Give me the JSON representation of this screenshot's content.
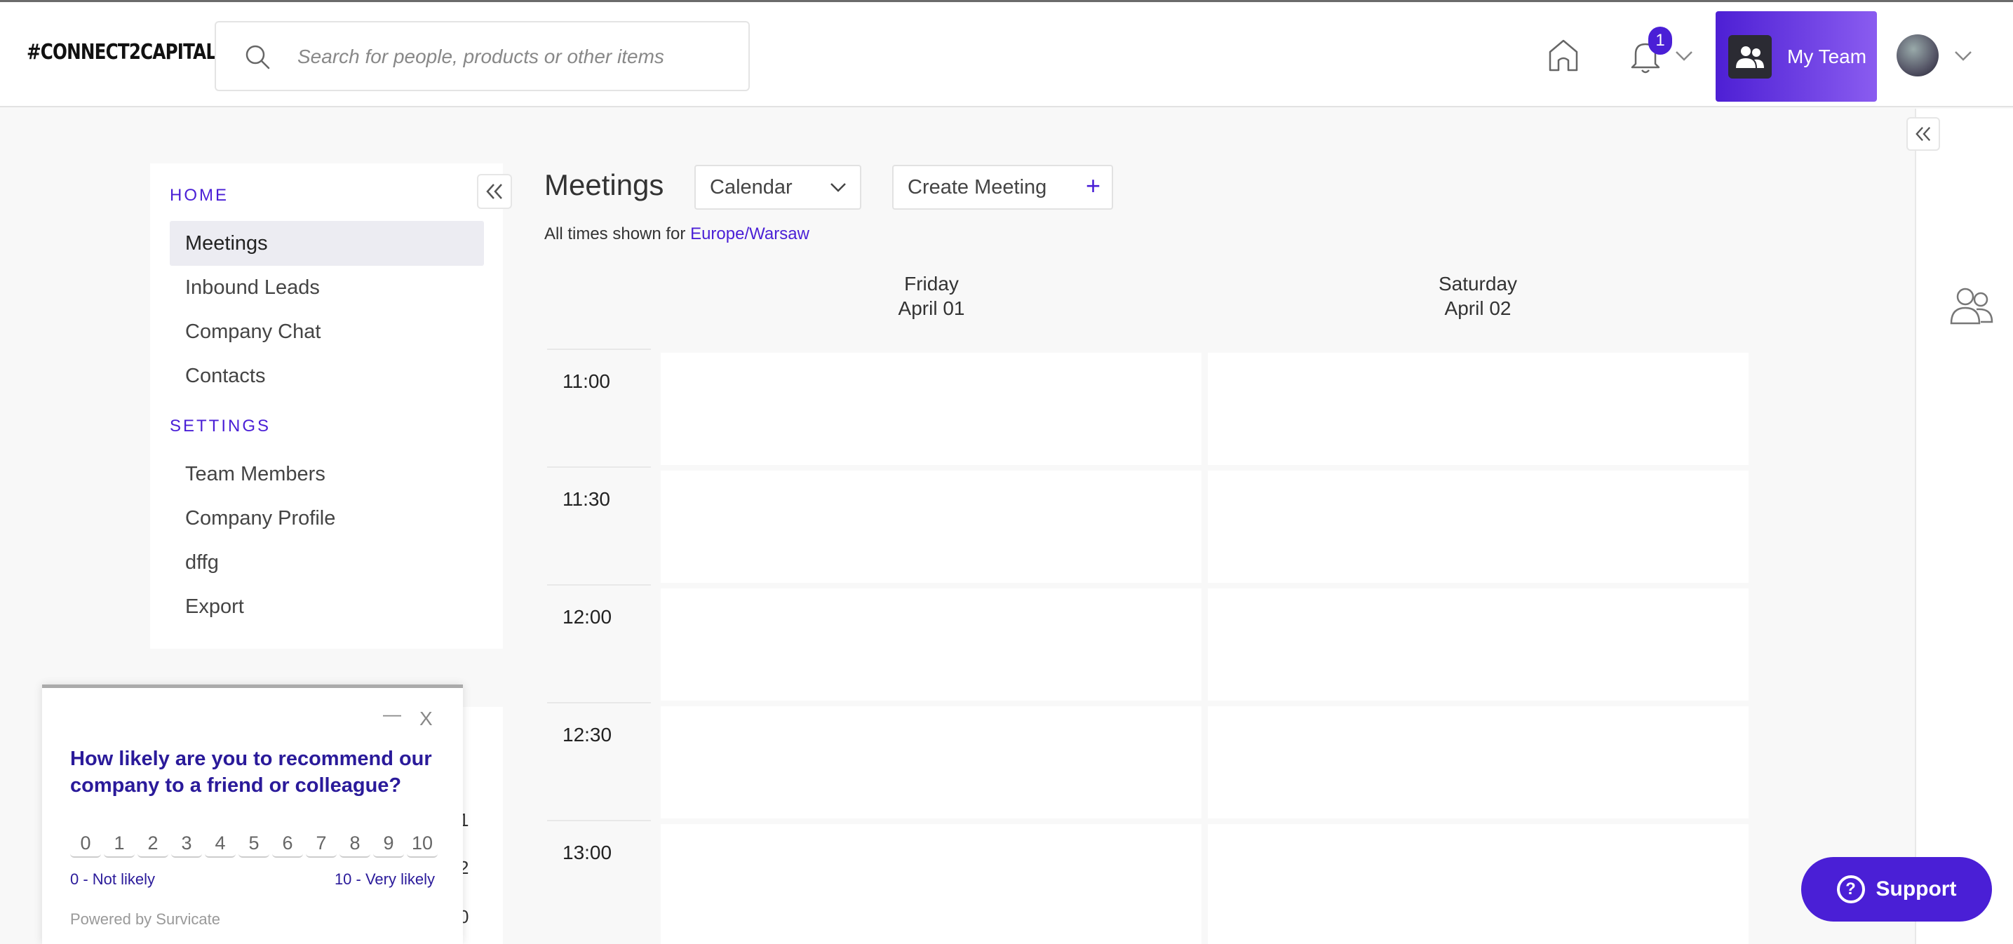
{
  "header": {
    "logo": "#CONNECT2CAPITAL",
    "search_placeholder": "Search for people, products or other items",
    "notification_count": "1",
    "my_team_label": "My Team"
  },
  "sidebar": {
    "home_title": "HOME",
    "home_items": [
      "Meetings",
      "Inbound Leads",
      "Company Chat",
      "Contacts"
    ],
    "settings_title": "SETTINGS",
    "settings_items": [
      "Team Members",
      "Company Profile",
      "dffg",
      "Export"
    ],
    "obscured_numbers": [
      "1",
      "2",
      "0"
    ]
  },
  "main": {
    "title": "Meetings",
    "view_select": "Calendar",
    "create_label": "Create Meeting",
    "timezone_prefix": "All times shown for",
    "timezone": "Europe/Warsaw",
    "days": [
      {
        "weekday": "Friday",
        "date": "April 01"
      },
      {
        "weekday": "Saturday",
        "date": "April 02"
      }
    ],
    "times": [
      "11:00",
      "11:30",
      "12:00",
      "12:30",
      "13:00"
    ]
  },
  "survey": {
    "minimize": "—",
    "close": "X",
    "question": "How likely are you to recommend our company to a friend or colleague?",
    "scale": [
      "0",
      "1",
      "2",
      "3",
      "4",
      "5",
      "6",
      "7",
      "8",
      "9",
      "10"
    ],
    "low_label": "0 - Not likely",
    "high_label": "10 - Very likely",
    "powered_by": "Powered by Survicate"
  },
  "support": {
    "label": "Support"
  },
  "colors": {
    "accent": "#4a1fd6",
    "background": "#f8f8f8"
  }
}
